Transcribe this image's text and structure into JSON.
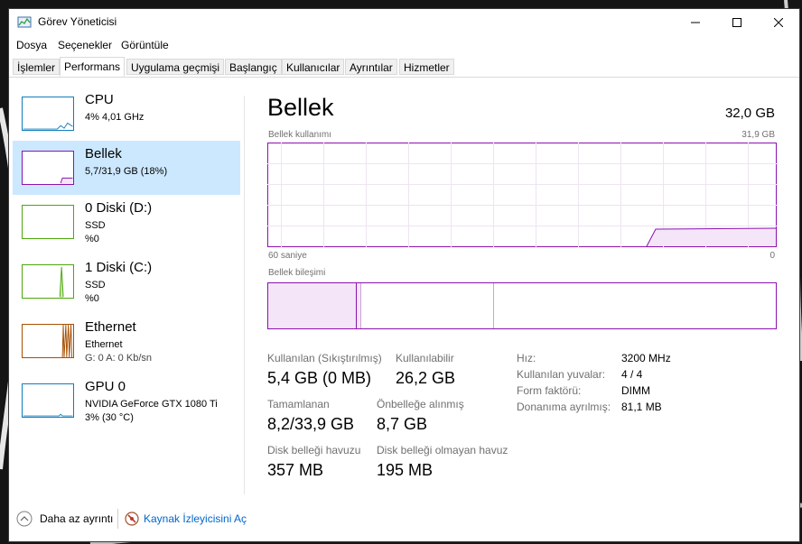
{
  "window": {
    "title": "Görev Yöneticisi"
  },
  "menu": [
    "Dosya",
    "Seçenekler",
    "Görüntüle"
  ],
  "tabs": [
    "İşlemler",
    "Performans",
    "Uygulama geçmişi",
    "Başlangıç",
    "Kullanıcılar",
    "Ayrıntılar",
    "Hizmetler"
  ],
  "active_tab": "Performans",
  "sidebar": [
    {
      "title": "CPU",
      "sub1": "4% 4,01 GHz",
      "sub2": "",
      "color": "#117dbb"
    },
    {
      "title": "Bellek",
      "sub1": "5,7/31,9 GB (18%)",
      "sub2": "",
      "color": "#8b12ae"
    },
    {
      "title": "0 Diski (D:)",
      "sub1": "SSD",
      "sub2": "%0",
      "color": "#4da60c"
    },
    {
      "title": "1 Diski (C:)",
      "sub1": "SSD",
      "sub2": "%0",
      "color": "#4da60c"
    },
    {
      "title": "Ethernet",
      "sub1": "Ethernet",
      "sub2": "G: 0 A: 0 Kb/sn",
      "color": "#a74f01"
    },
    {
      "title": "GPU 0",
      "sub1": "NVIDIA GeForce GTX 1080 Ti",
      "sub2": "3% (30 °C)",
      "color": "#117dbb"
    }
  ],
  "main": {
    "title": "Bellek",
    "total": "32,0 GB",
    "usage_label": "Bellek kullanımı",
    "usage_max": "31,9 GB",
    "axis_left": "60 saniye",
    "axis_right": "0",
    "composition_label": "Bellek bileşimi",
    "accent": "#8b12ae",
    "usage_fraction": 0.18,
    "stats": {
      "in_use_label": "Kullanılan (Sıkıştırılmış)",
      "in_use_value": "5,4 GB (0 MB)",
      "available_label": "Kullanılabilir",
      "available_value": "26,2 GB",
      "committed_label": "Tamamlanan",
      "committed_value": "8,2/33,9 GB",
      "cached_label": "Önbelleğe alınmış",
      "cached_value": "8,7 GB",
      "paged_label": "Disk belleği havuzu",
      "paged_value": "357 MB",
      "nonpaged_label": "Disk belleği olmayan havuz",
      "nonpaged_value": "195 MB"
    },
    "details": [
      {
        "label": "Hız:",
        "value": "3200 MHz"
      },
      {
        "label": "Kullanılan yuvalar:",
        "value": "4 / 4"
      },
      {
        "label": "Form faktörü:",
        "value": "DIMM"
      },
      {
        "label": "Donanıma ayrılmış:",
        "value": "81,1 MB"
      }
    ]
  },
  "footer": {
    "less_details": "Daha az ayrıntı",
    "resource_monitor": "Kaynak İzleyicisini Aç"
  }
}
